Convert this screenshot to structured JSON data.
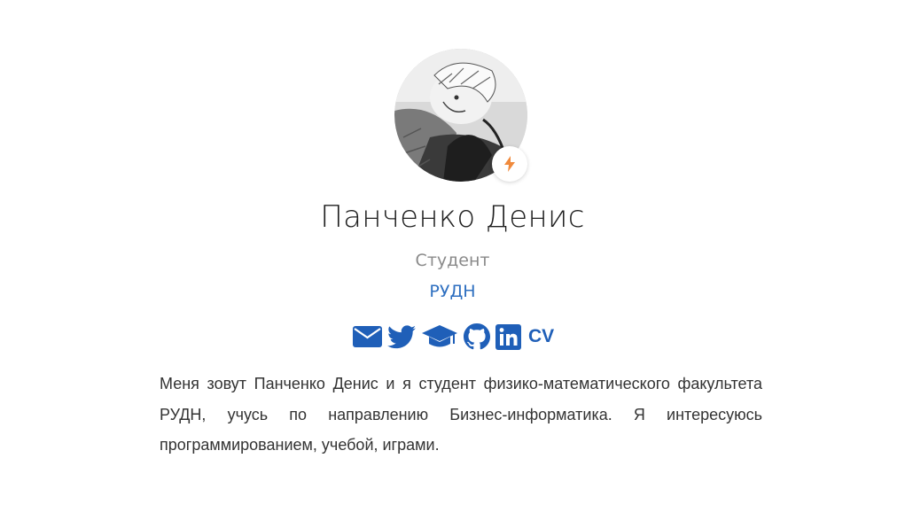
{
  "profile": {
    "name": "Панченко Денис",
    "role": "Студент",
    "organization": "РУДН",
    "bio": "Меня зовут Панченко Денис и я студент физико-математического факультета РУДН, учусь по направлению Бизнес-информатика. Я интересуюсь программированием, учебой, играми.",
    "status_icon": "lightning-bolt-icon"
  },
  "social_links": [
    {
      "icon": "envelope-icon"
    },
    {
      "icon": "twitter-icon"
    },
    {
      "icon": "graduation-cap-icon"
    },
    {
      "icon": "github-icon"
    },
    {
      "icon": "linkedin-icon"
    },
    {
      "icon": "cv-icon",
      "label": "CV"
    }
  ],
  "colors": {
    "accent": "#2e6fc0",
    "social_icons": "#1f5fb8",
    "status_bolt": "#f08a3c",
    "name_text": "#1f1f1f",
    "role_text": "#8a8a8a",
    "body_text": "#333333"
  }
}
